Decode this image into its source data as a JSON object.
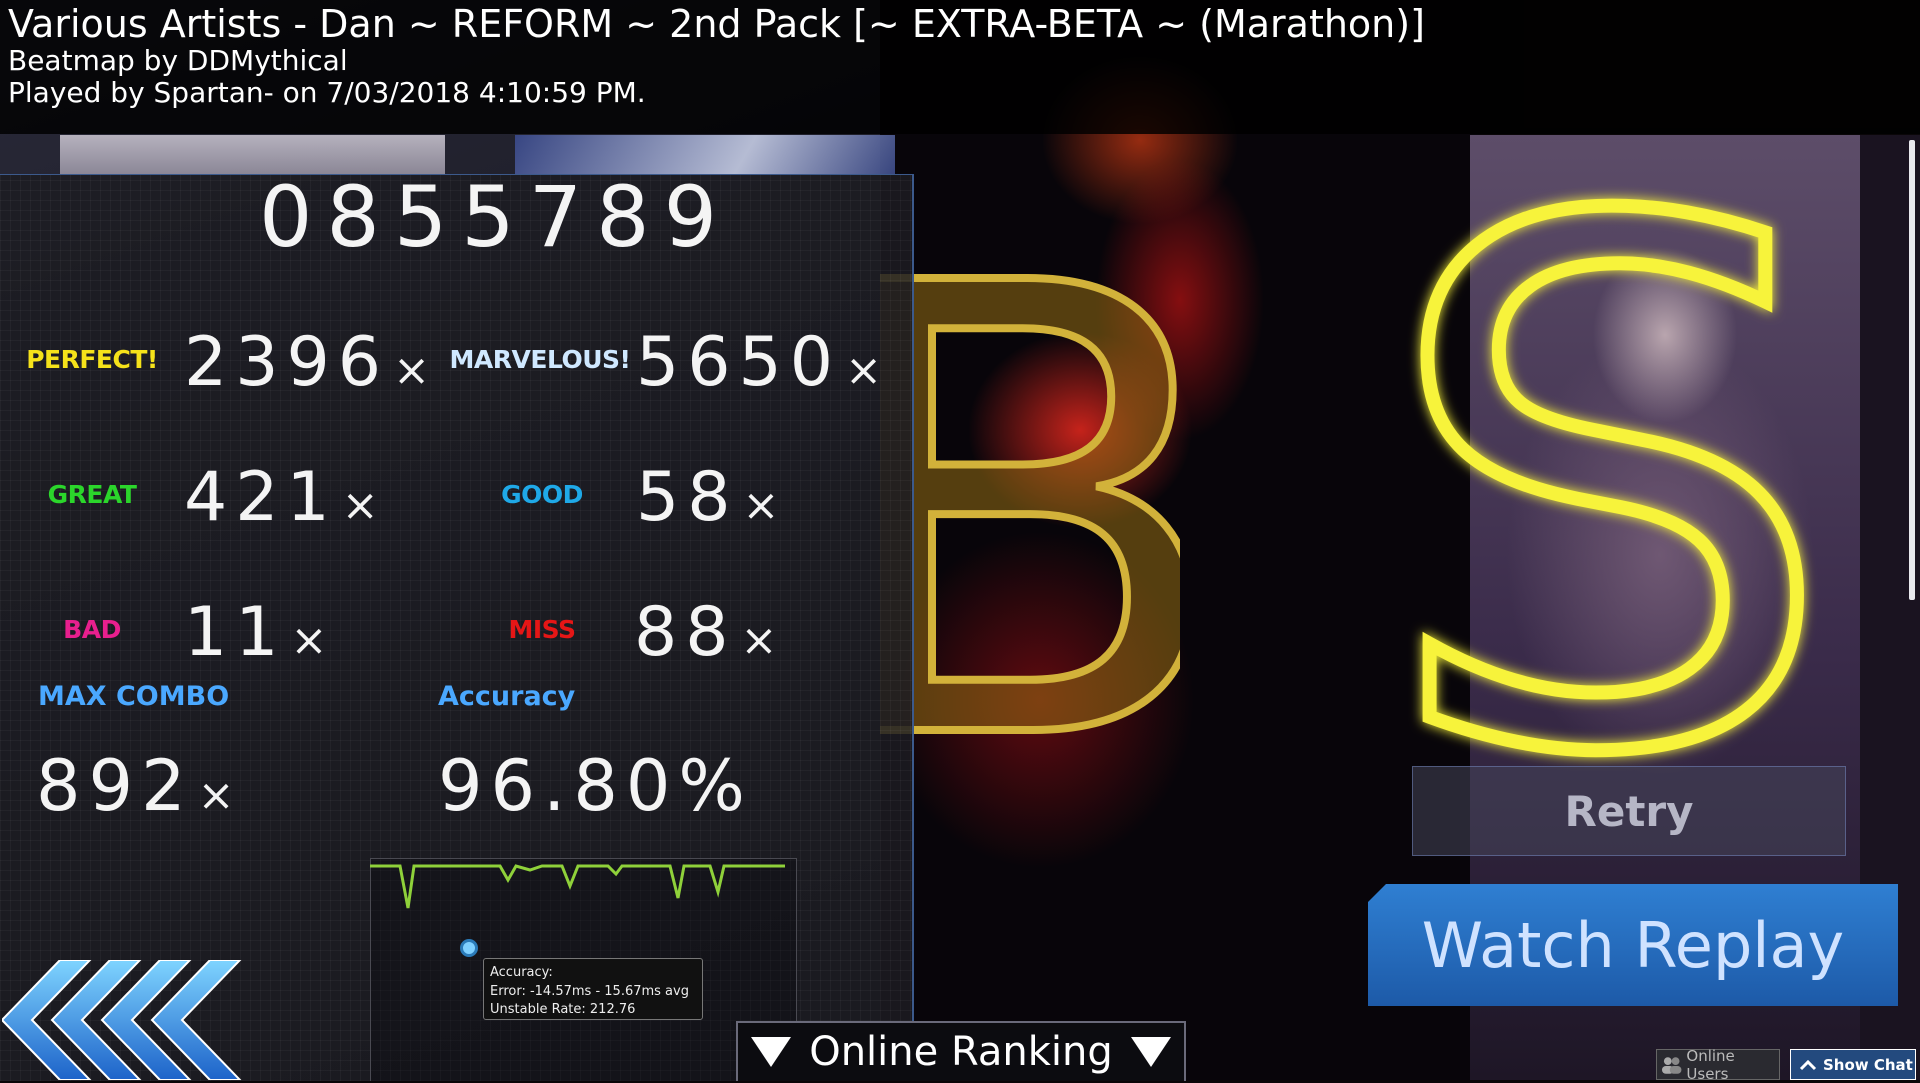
{
  "header": {
    "title": "Various Artists - Dan ~ REFORM ~ 2nd Pack [~ EXTRA-BETA ~ (Marathon)]",
    "mapper": "Beatmap by DDMythical",
    "played": "Played by Spartan- on 7/03/2018 4:10:59 PM."
  },
  "score": "0855789",
  "judgements": [
    {
      "label": "PERFECT!",
      "count": "2396",
      "color": "#f5e21a"
    },
    {
      "label": "MARVELOUS!",
      "count": "5650",
      "color": "#cfe8ff"
    },
    {
      "label": "GREAT",
      "count": "421",
      "color": "#2bd62b"
    },
    {
      "label": "GOOD",
      "count": "58",
      "color": "#1fa9e8"
    },
    {
      "label": "BAD",
      "count": "11",
      "color": "#e81f8e"
    },
    {
      "label": "MISS",
      "count": "88",
      "color": "#e51616"
    }
  ],
  "multiplier_symbol": "×",
  "max_combo": {
    "label": "MAX COMBO",
    "value": "892"
  },
  "accuracy": {
    "label": "Accuracy",
    "value": "96.80%"
  },
  "tooltip": {
    "line1": "Accuracy:",
    "line2": "Error: -14.57ms - 15.67ms avg",
    "line3": "Unstable Rate: 212.76"
  },
  "ranks": {
    "background_rank": "B",
    "rank": "S"
  },
  "buttons": {
    "retry": "Retry",
    "watch_replay": "Watch Replay",
    "online_ranking": "Online Ranking",
    "online_users": "Online Users",
    "show_chat": "Show Chat"
  },
  "colors": {
    "accent_blue": "#4aa8ff",
    "rank_s": "#f7f33a",
    "rank_b": "#b89a2a",
    "graph_line": "#8fd13a"
  },
  "icons": [
    "back-chevrons-icon",
    "triangle-down-icon",
    "users-icon",
    "chevron-up-icon"
  ]
}
